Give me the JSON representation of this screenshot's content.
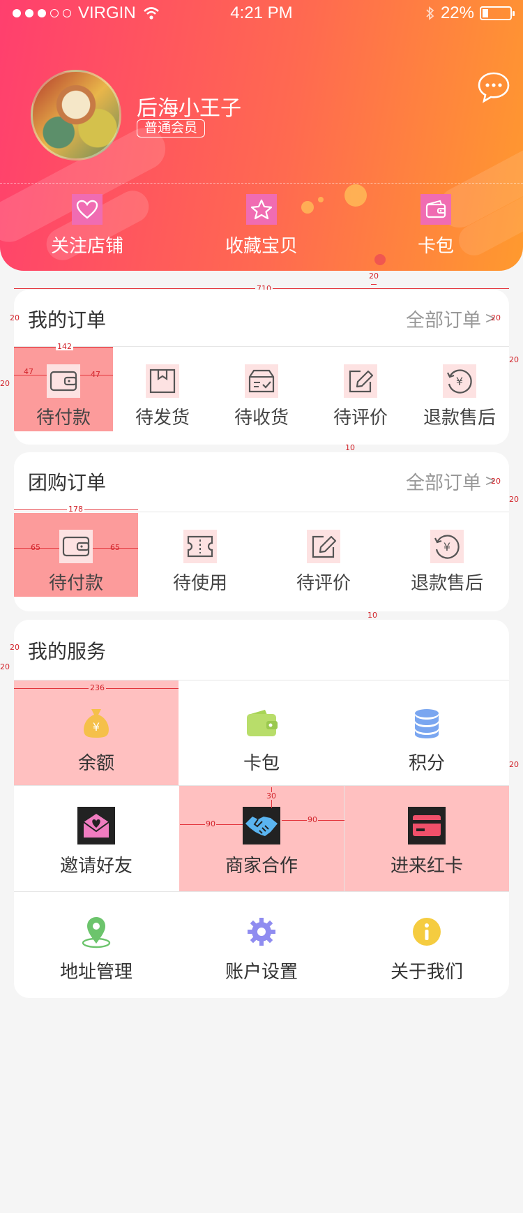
{
  "status_bar": {
    "carrier": "VIRGIN",
    "time": "4:21 PM",
    "battery": "22%"
  },
  "profile": {
    "username": "后海小王子",
    "member_level": "普通会员"
  },
  "quick_actions": [
    {
      "label": "关注店铺",
      "icon": "heart-icon"
    },
    {
      "label": "收藏宝贝",
      "icon": "star-icon"
    },
    {
      "label": "卡包",
      "icon": "wallet-icon"
    }
  ],
  "my_orders": {
    "title": "我的订单",
    "more": "全部订单",
    "items": [
      {
        "label": "待付款",
        "icon": "wallet-icon"
      },
      {
        "label": "待发货",
        "icon": "box-icon"
      },
      {
        "label": "待收货",
        "icon": "delivery-check-icon"
      },
      {
        "label": "待评价",
        "icon": "edit-icon"
      },
      {
        "label": "退款售后",
        "icon": "refund-icon"
      }
    ]
  },
  "group_orders": {
    "title": "团购订单",
    "more": "全部订单",
    "items": [
      {
        "label": "待付款",
        "icon": "wallet-icon"
      },
      {
        "label": "待使用",
        "icon": "ticket-icon"
      },
      {
        "label": "待评价",
        "icon": "edit-icon"
      },
      {
        "label": "退款售后",
        "icon": "refund-icon"
      }
    ]
  },
  "services": {
    "title": "我的服务",
    "items": [
      {
        "label": "余额",
        "icon": "money-bag-icon",
        "color": "#f5c04a"
      },
      {
        "label": "卡包",
        "icon": "wallet-icon",
        "color": "#b8dd6a"
      },
      {
        "label": "积分",
        "icon": "coins-stack-icon",
        "color": "#7aa6f0"
      },
      {
        "label": "邀请好友",
        "icon": "invite-letter-icon",
        "color": "#f07cc0"
      },
      {
        "label": "商家合作",
        "icon": "handshake-icon",
        "color": "#5ab4f0"
      },
      {
        "label": "进来红卡",
        "icon": "red-card-icon",
        "color": "#f0506a"
      },
      {
        "label": "地址管理",
        "icon": "location-pin-icon",
        "color": "#6cc46c"
      },
      {
        "label": "账户设置",
        "icon": "gear-icon",
        "color": "#8f8cf0"
      },
      {
        "label": "关于我们",
        "icon": "info-icon",
        "color": "#f5cc40"
      }
    ]
  },
  "annotations": {
    "a20": "20",
    "a710": "710",
    "a142": "142",
    "a47": "47",
    "a10": "10",
    "a178": "178",
    "a65": "65",
    "a236": "236",
    "a30": "30",
    "a90": "90"
  },
  "colors": {
    "header_start": "#ff3f6e",
    "header_end": "#ff9a2e",
    "highlight": "#fc9b9b",
    "annotation": "#d2232a"
  }
}
